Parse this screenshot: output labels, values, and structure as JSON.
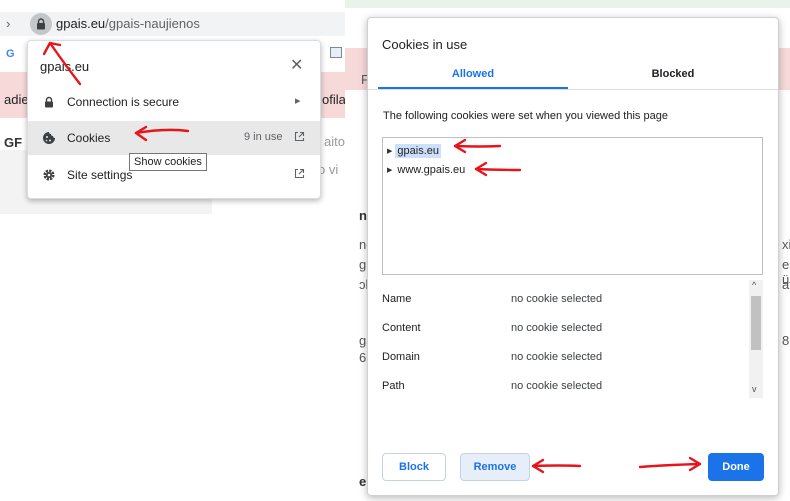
{
  "left": {
    "address_bar": {
      "leading_glyph": "›",
      "url_domain": "gpais.eu",
      "url_path": "/gpais-naujienos"
    },
    "background": {
      "bookmark_glyph": "G",
      "text_1": "adie",
      "text_2": "ofila",
      "text_3": "GF",
      "text_4": "aitos",
      "text_5": "o vi"
    },
    "site_popup": {
      "title": "gpais.eu",
      "close_glyph": "✕",
      "items": [
        {
          "label": "Connection is secure",
          "icon": "lock-icon",
          "trailing": "▸"
        },
        {
          "label": "Cookies",
          "icon": "cookie-icon",
          "count": "9 in use",
          "trailing": "external-link-icon"
        },
        {
          "label": "Site settings",
          "icon": "gear-icon",
          "trailing": "external-link-icon"
        }
      ],
      "tooltip": "Show cookies"
    }
  },
  "right": {
    "background_fragments": [
      "F",
      "nu",
      "né",
      "g C",
      "ɔk",
      "ga",
      "6",
      "xio",
      "e ü",
      "af",
      "8",
      "er"
    ],
    "dialog": {
      "title": "Cookies in use",
      "tabs": [
        {
          "label": "Allowed",
          "selected": true
        },
        {
          "label": "Blocked",
          "selected": false
        }
      ],
      "description": "The following cookies were set when you viewed this page",
      "tree": [
        {
          "label": "gpais.eu",
          "selected": true
        },
        {
          "label": "www.gpais.eu",
          "selected": false
        }
      ],
      "details": [
        {
          "label": "Name",
          "value": "no cookie selected"
        },
        {
          "label": "Content",
          "value": "no cookie selected"
        },
        {
          "label": "Domain",
          "value": "no cookie selected"
        },
        {
          "label": "Path",
          "value": "no cookie selected"
        }
      ],
      "buttons": {
        "block": "Block",
        "remove": "Remove",
        "done": "Done"
      }
    }
  },
  "colors": {
    "accent": "#1a73e8",
    "annotation": "#e8141c",
    "pink_banner": "#f7d9d9",
    "selection": "#cce0fa"
  }
}
